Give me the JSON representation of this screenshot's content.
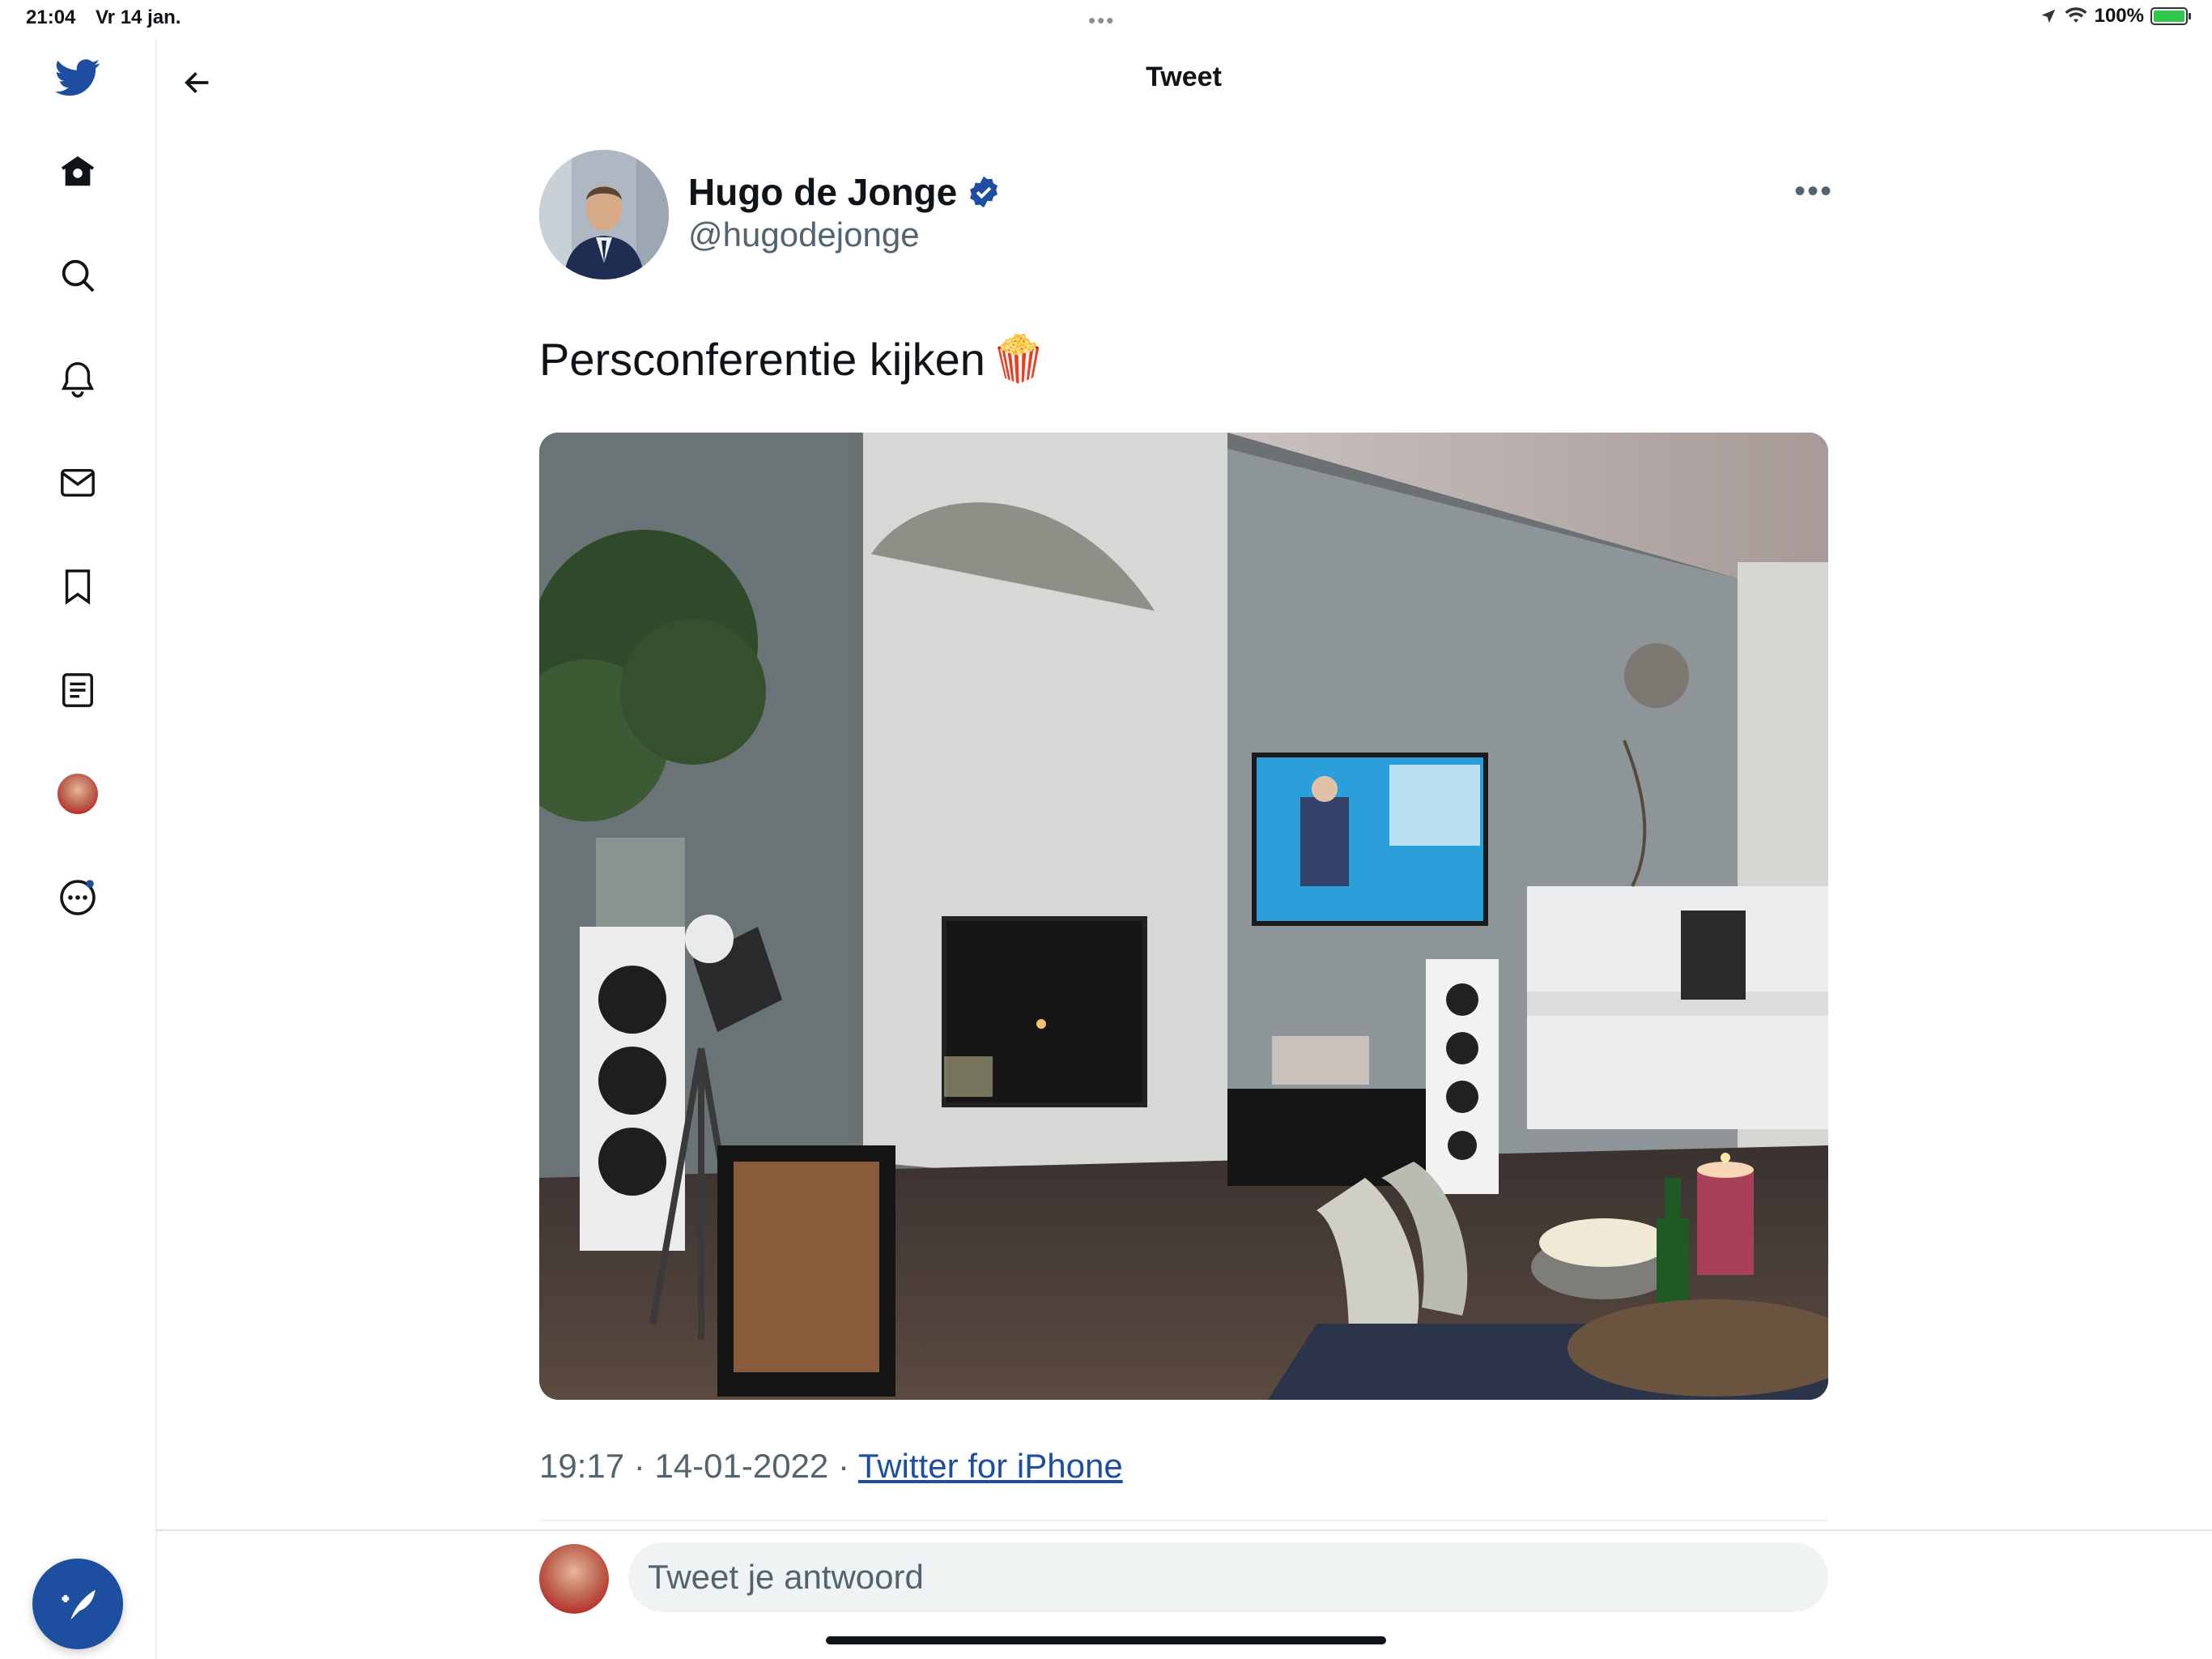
{
  "status_bar": {
    "time": "21:04",
    "date": "Vr 14 jan.",
    "battery": "100%"
  },
  "header": {
    "title": "Tweet"
  },
  "sidebar": {
    "items": [
      {
        "icon": "twitter-bird-icon"
      },
      {
        "icon": "home-icon"
      },
      {
        "icon": "search-icon"
      },
      {
        "icon": "bell-icon"
      },
      {
        "icon": "mail-icon"
      },
      {
        "icon": "bookmark-icon"
      },
      {
        "icon": "lists-icon"
      },
      {
        "icon": "profile-avatar"
      },
      {
        "icon": "more-icon"
      }
    ],
    "compose": "compose-tweet-icon"
  },
  "tweet": {
    "author_name": "Hugo de Jonge",
    "author_handle": "@hugodejonge",
    "text": "Persconferentie kijken",
    "emoji": "🍿",
    "time": "19:17",
    "date": "14-01-2022",
    "separator": "·",
    "source": "Twitter for iPhone"
  },
  "reply": {
    "placeholder": "Tweet je antwoord"
  },
  "colors": {
    "brand": "#1d4ea0",
    "text_secondary": "#536471"
  }
}
